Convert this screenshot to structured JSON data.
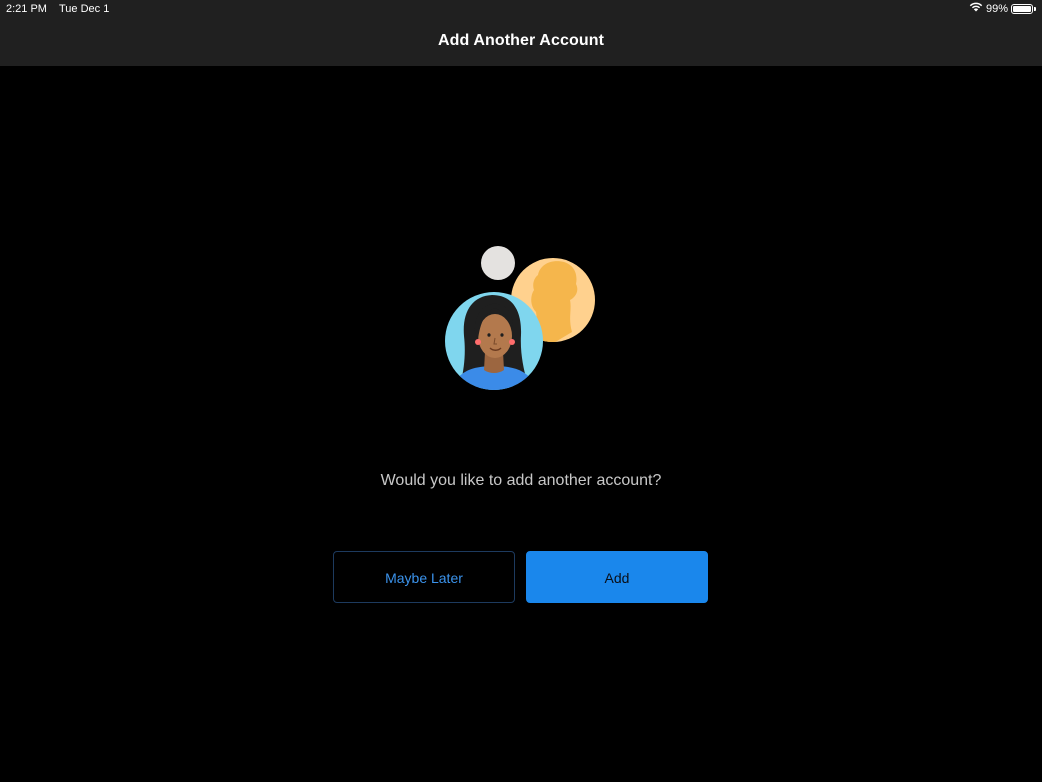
{
  "status_bar": {
    "time": "2:21 PM",
    "date": "Tue Dec 1",
    "battery": "99%",
    "battery_level": 0.99
  },
  "nav": {
    "title": "Add Another Account"
  },
  "illustration": {
    "icon": "accounts-illustration",
    "colors": {
      "gray_dot": "#e4e2e0",
      "orange_circle": "#ffd18e",
      "orange_silhouette": "#f5b64c",
      "blue_circle": "#7fd6ee",
      "shirt": "#3b8be8",
      "skin": "#b3794d",
      "hair": "#1f1f1f"
    }
  },
  "content": {
    "prompt": "Would you like to add another account?"
  },
  "buttons": {
    "maybe_later": "Maybe Later",
    "add": "Add"
  },
  "colors": {
    "background": "#000000",
    "nav_background": "#202020",
    "accent": "#1a87ec",
    "prompt_text": "#c8c8c8"
  }
}
